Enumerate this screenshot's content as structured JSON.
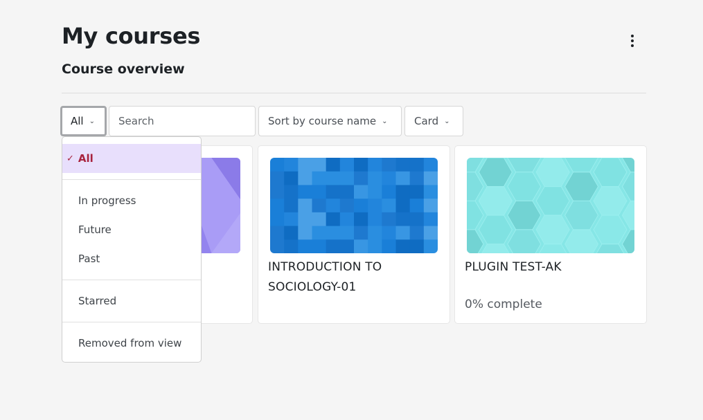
{
  "page": {
    "title": "My courses",
    "section_title": "Course overview"
  },
  "controls": {
    "filter_label": "All",
    "search_placeholder": "Search",
    "sort_label": "Sort by course name",
    "view_label": "Card"
  },
  "filter_menu": {
    "selected": "All",
    "items": [
      "All",
      "In progress",
      "Future",
      "Past",
      "Starred",
      "Removed from view"
    ]
  },
  "courses": [
    {
      "name": "",
      "thumbnail": "purple-geometric",
      "progress": ""
    },
    {
      "name": "INTRODUCTION TO SOCIOLOGY-01",
      "thumbnail": "blue-mosaic",
      "progress": ""
    },
    {
      "name": "PLUGIN TEST-AK",
      "thumbnail": "teal-hexagon",
      "progress": "0% complete"
    }
  ],
  "colors": {
    "background": "#f5f5f5",
    "active_item_bg": "#e8dffc",
    "active_item_text": "#a8233e"
  }
}
